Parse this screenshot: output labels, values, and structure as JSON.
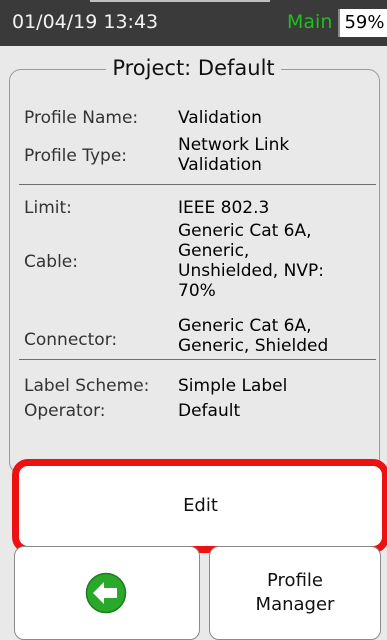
{
  "statusbar": {
    "datetime": "01/04/19 13:43",
    "mode": "Main",
    "battery": "59%"
  },
  "project": {
    "title": "Project: Default",
    "profile_name_label": "Profile Name:",
    "profile_name_value": "Validation",
    "profile_type_label": "Profile Type:",
    "profile_type_value": [
      "Network Link",
      "Validation"
    ],
    "limit_label": "Limit:",
    "limit_value": "IEEE 802.3",
    "cable_label": "Cable:",
    "cable_value": [
      "Generic Cat 6A,",
      "Generic,",
      "Unshielded, NVP:",
      "70%"
    ],
    "connector_label": "Connector:",
    "connector_value": [
      "Generic Cat 6A,",
      "Generic, Shielded"
    ],
    "label_scheme_label": "Label Scheme:",
    "label_scheme_value": "Simple Label",
    "operator_label": "Operator:",
    "operator_value": "Default"
  },
  "buttons": {
    "edit_label": "Edit",
    "profile_manager_label": [
      "Profile",
      "Manager"
    ]
  },
  "colors": {
    "mode": "#1fbf1f",
    "highlight": "#ee1111",
    "back_icon": "#2aa82a"
  },
  "icons": {
    "back": "back-arrow-icon"
  }
}
